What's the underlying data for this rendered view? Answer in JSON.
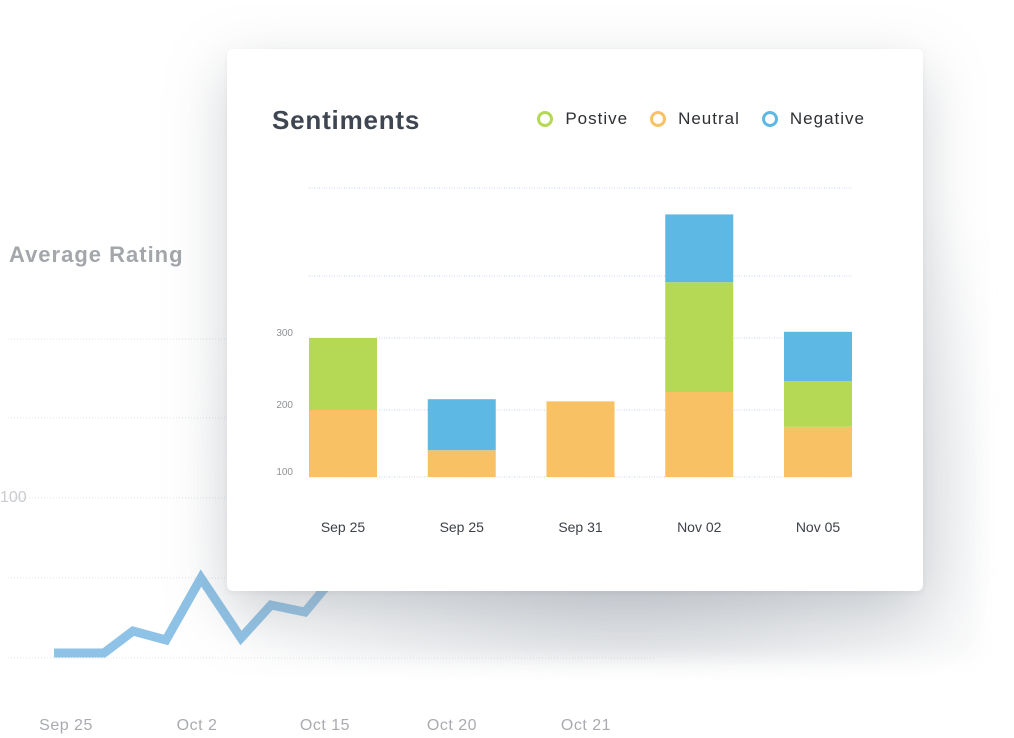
{
  "background_chart": {
    "title": "Average Rating",
    "y_tick_label": "100",
    "x_labels": [
      "Sep 25",
      "Oct 2",
      "Oct 15",
      "Oct 20",
      "Oct 21"
    ],
    "line_color": "#8ec2e6",
    "type": "line"
  },
  "card": {
    "title": "Sentiments",
    "legend": [
      {
        "label": "Postive",
        "color": "#b5d955"
      },
      {
        "label": "Neutral",
        "color": "#f8c264"
      },
      {
        "label": "Negative",
        "color": "#5db9e4"
      }
    ]
  },
  "chart_data": {
    "type": "bar",
    "stacked": true,
    "title": "Sentiments",
    "categories": [
      "Sep 25",
      "Sep 25",
      "Sep 31",
      "Nov 02",
      "Nov 05"
    ],
    "series": [
      {
        "name": "Neutral",
        "color": "#f8c264",
        "values": [
          100,
          40,
          112,
          125,
          75
        ]
      },
      {
        "name": "Postive",
        "color": "#b5d955",
        "values": [
          100,
          0,
          0,
          165,
          65
        ]
      },
      {
        "name": "Negative",
        "color": "#5db9e4",
        "values": [
          0,
          75,
          0,
          80,
          70
        ]
      }
    ],
    "baseline": 100,
    "y_ticks": [
      100,
      200,
      300
    ],
    "gridlines": [
      100,
      200,
      300,
      400,
      500
    ],
    "ylim": [
      100,
      500
    ],
    "xlabel": "",
    "ylabel": "",
    "grid": true,
    "legend_position": "top-right"
  }
}
